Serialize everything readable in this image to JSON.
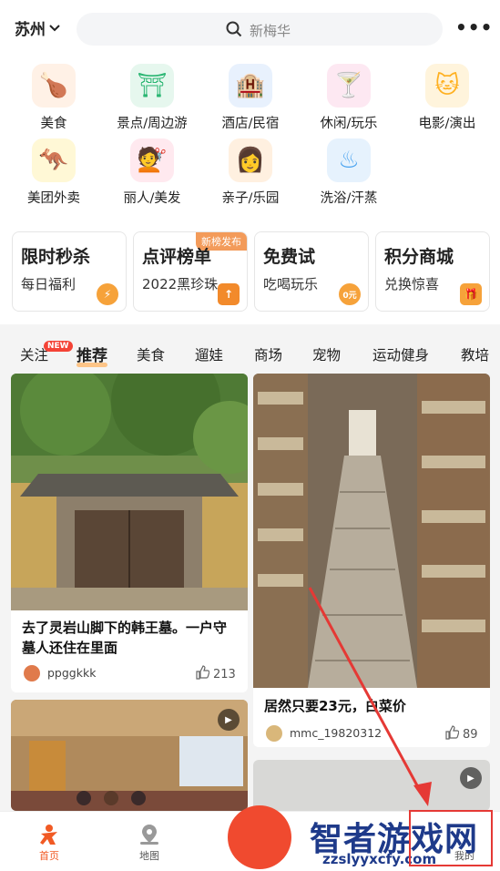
{
  "header": {
    "city": "苏州",
    "search_placeholder": "新梅华",
    "more": "•••"
  },
  "categories": [
    {
      "label": "美食",
      "icon": "roast-chicken-icon",
      "color": "#ff8a2b",
      "glyph": "🍗"
    },
    {
      "label": "景点/周边游",
      "icon": "pagoda-icon",
      "color": "#2bb673",
      "glyph": "⛩"
    },
    {
      "label": "酒店/民宿",
      "icon": "hotel-building-icon",
      "color": "#2f7de1",
      "glyph": "🏨"
    },
    {
      "label": "休闲/玩乐",
      "icon": "cocktail-icon",
      "color": "#f25fa5",
      "glyph": "🍸"
    },
    {
      "label": "电影/演出",
      "icon": "cat-mask-icon",
      "color": "#ffb020",
      "glyph": "🐱"
    },
    {
      "label": "美团外卖",
      "icon": "kangaroo-icon",
      "color": "#ffcf2e",
      "glyph": "🦘"
    },
    {
      "label": "丽人/美发",
      "icon": "woman-hair-icon",
      "color": "#ff6f91",
      "glyph": "💇"
    },
    {
      "label": "亲子/乐园",
      "icon": "parent-child-icon",
      "color": "#ff9f43",
      "glyph": "👩"
    },
    {
      "label": "洗浴/汗蒸",
      "icon": "bathtub-icon",
      "color": "#4aa3f0",
      "glyph": "♨"
    }
  ],
  "promos": [
    {
      "title": "限时秒杀",
      "sub": "每日福利",
      "icon": "lightning-icon",
      "color": "#f6a23a",
      "glyph": "⚡"
    },
    {
      "title": "点评榜单",
      "sub": "2022黑珍珠",
      "badge": "新榜发布",
      "icon": "ranking-arrow-icon",
      "color": "#f28a2b",
      "glyph": "↑"
    },
    {
      "title": "免费试",
      "sub": "吃喝玩乐",
      "icon": "zero-yuan-icon",
      "color": "#f6a23a",
      "glyph": "0元"
    },
    {
      "title": "积分商城",
      "sub": "兑换惊喜",
      "icon": "gift-box-icon",
      "color": "#f6a23a",
      "glyph": "🎁"
    }
  ],
  "tabs": {
    "items": [
      "关注",
      "推荐",
      "美食",
      "遛娃",
      "商场",
      "宠物",
      "运动健身",
      "教培"
    ],
    "new_badge": "NEW"
  },
  "feed": [
    {
      "title": "去了灵岩山脚下的韩王墓。一户守墓人还住在里面",
      "user": "ppggkkk",
      "likes": "213"
    },
    {
      "title": "居然只要23元，白菜价",
      "user": "mmc_19820312",
      "likes": "89"
    }
  ],
  "bottom_nav": {
    "home": "首页",
    "map": "地图",
    "profile": "我的"
  },
  "watermark": {
    "site": "智者游戏网",
    "url": "zzslyyxcfy.com"
  }
}
